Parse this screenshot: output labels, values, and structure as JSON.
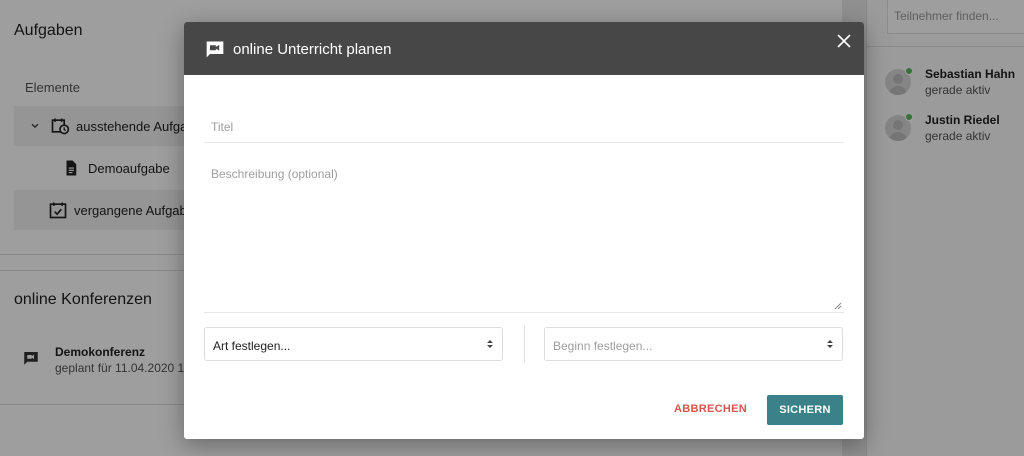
{
  "background": {
    "aufgaben_card": {
      "title": "Aufgaben",
      "section_label": "Elemente",
      "items": [
        {
          "label": "ausstehende Aufgaben",
          "icon": "calendar-clock-icon",
          "expanded": true
        },
        {
          "label": "Demoaufgabe",
          "icon": "document-icon"
        },
        {
          "label": "vergangene Aufgaben",
          "icon": "calendar-check-icon"
        }
      ]
    },
    "konferenzen_card": {
      "title": "online Konferenzen",
      "item": {
        "title": "Demokonferenz",
        "subtitle": "geplant für 11.04.2020 1",
        "icon": "video-chat-icon"
      }
    },
    "participants": {
      "search_placeholder": "Teilnehmer finden...",
      "list": [
        {
          "name": "Sebastian Hahn",
          "status": "gerade aktiv"
        },
        {
          "name": "Justin Riedel",
          "status": "gerade aktiv"
        }
      ]
    }
  },
  "modal": {
    "title": "online Unterricht planen",
    "title_field_placeholder": "Titel",
    "description_placeholder": "Beschreibung (optional)",
    "type_select": "Art festlegen...",
    "start_select": "Beginn festlegen...",
    "cancel_label": "ABBRECHEN",
    "save_label": "SICHERN"
  },
  "colors": {
    "header_bg": "#474747",
    "save_button": "#3a8189",
    "cancel_text": "#d9534f",
    "online_dot": "#5cb85c"
  }
}
